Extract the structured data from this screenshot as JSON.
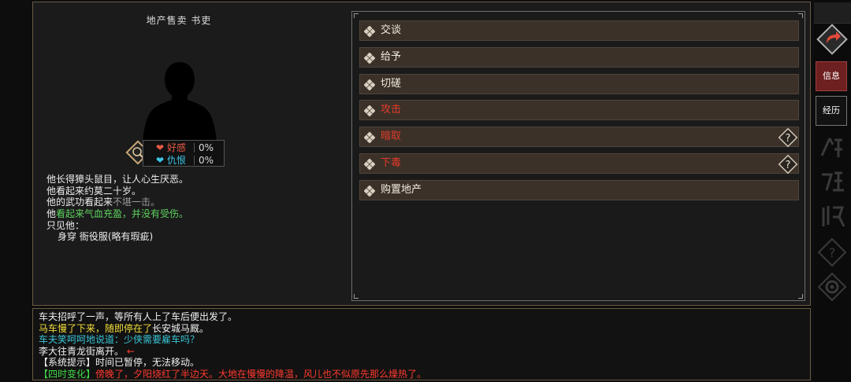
{
  "npc": {
    "title": "地产售卖 书吏",
    "relations": [
      {
        "label": "好感",
        "value": "0%",
        "color": "#e85a45"
      },
      {
        "label": "仇恨",
        "value": "0%",
        "color": "#3ec7e8"
      }
    ],
    "description": {
      "line1": "他长得獐头鼠目，让人心生厌恶。",
      "line2": "他看起来约莫二十岁。",
      "line3_prefix": "他的武功看起来",
      "line3_grey": "不堪一击。",
      "line4_prefix": "他",
      "line4_green": "看起来气血充盈，并没有受伤。",
      "line5": "只见他：",
      "line6_label": "身穿",
      "line6_item": "衙役服",
      "line6_note": "(略有瑕疵)"
    }
  },
  "actions": [
    {
      "label": "交谈",
      "style": "normal",
      "help": false
    },
    {
      "label": "给予",
      "style": "normal",
      "help": false
    },
    {
      "label": "切磋",
      "style": "normal",
      "help": false
    },
    {
      "label": "攻击",
      "style": "red",
      "help": false
    },
    {
      "label": "暗取",
      "style": "red",
      "help": true
    },
    {
      "label": "下毒",
      "style": "red",
      "help": true
    },
    {
      "label": "购置地产",
      "style": "normal",
      "help": false
    }
  ],
  "log": {
    "l1": "车夫招呼了一声，等所有人上了车后便出发了。",
    "l2_yellow": "马车慢了下来，随即停在了",
    "l2_white": "长安城马厩。",
    "l3": "车夫笑呵呵地说道：少侠需要雇车吗？",
    "l4_text": "李大往青龙街离开。",
    "l4_arrow": "←",
    "l5": "【系统提示】时间已暂停，无法移动。",
    "l6_tag": "【四时变化】",
    "l6_text": "傍晚了，夕阳烧红了半边天。大地在慢慢的降温，风儿也不似原先那么燥热了。"
  },
  "sidebar": {
    "tab_info": "信息",
    "tab_exp": "经历",
    "icons": [
      "back-arrow-icon",
      "work-icon",
      "study-icon",
      "faction-icon",
      "question-icon",
      "gear-icon"
    ]
  },
  "colors": {
    "button_bg": "#3b3128",
    "panel_border": "#6a5a42",
    "red_text": "#e23b2b",
    "active_tab": "#6e1f1f"
  }
}
